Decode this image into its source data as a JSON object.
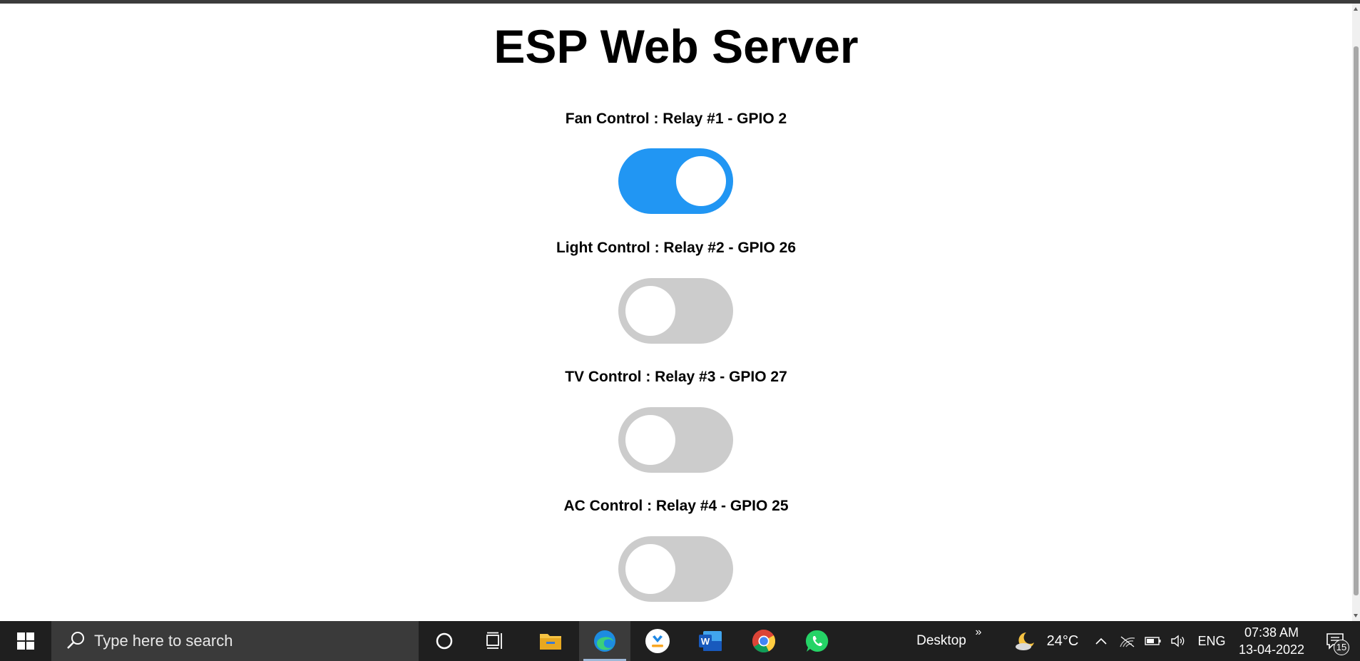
{
  "page": {
    "title": "ESP Web Server"
  },
  "relays": [
    {
      "label": "Fan Control : Relay #1 - GPIO 2",
      "state": "on"
    },
    {
      "label": "Light Control : Relay #2 - GPIO 26",
      "state": "off"
    },
    {
      "label": "TV Control : Relay #3 - GPIO 27",
      "state": "off"
    },
    {
      "label": "AC Control : Relay #4 - GPIO 25",
      "state": "off"
    }
  ],
  "colors": {
    "switch_on": "#2196f3",
    "switch_off": "#cccccc",
    "taskbar": "#1f1f1f"
  },
  "taskbar": {
    "search_placeholder": "Type here to search",
    "apps": [
      "cortana-icon",
      "task-view-icon",
      "file-explorer-icon",
      "edge-icon",
      "app-icon",
      "word-icon",
      "chrome-icon",
      "whatsapp-icon"
    ],
    "desktop_label": "Desktop",
    "weather_temp": "24°C",
    "language": "ENG",
    "time": "07:38 AM",
    "date": "13-04-2022",
    "notification_count": "15"
  }
}
